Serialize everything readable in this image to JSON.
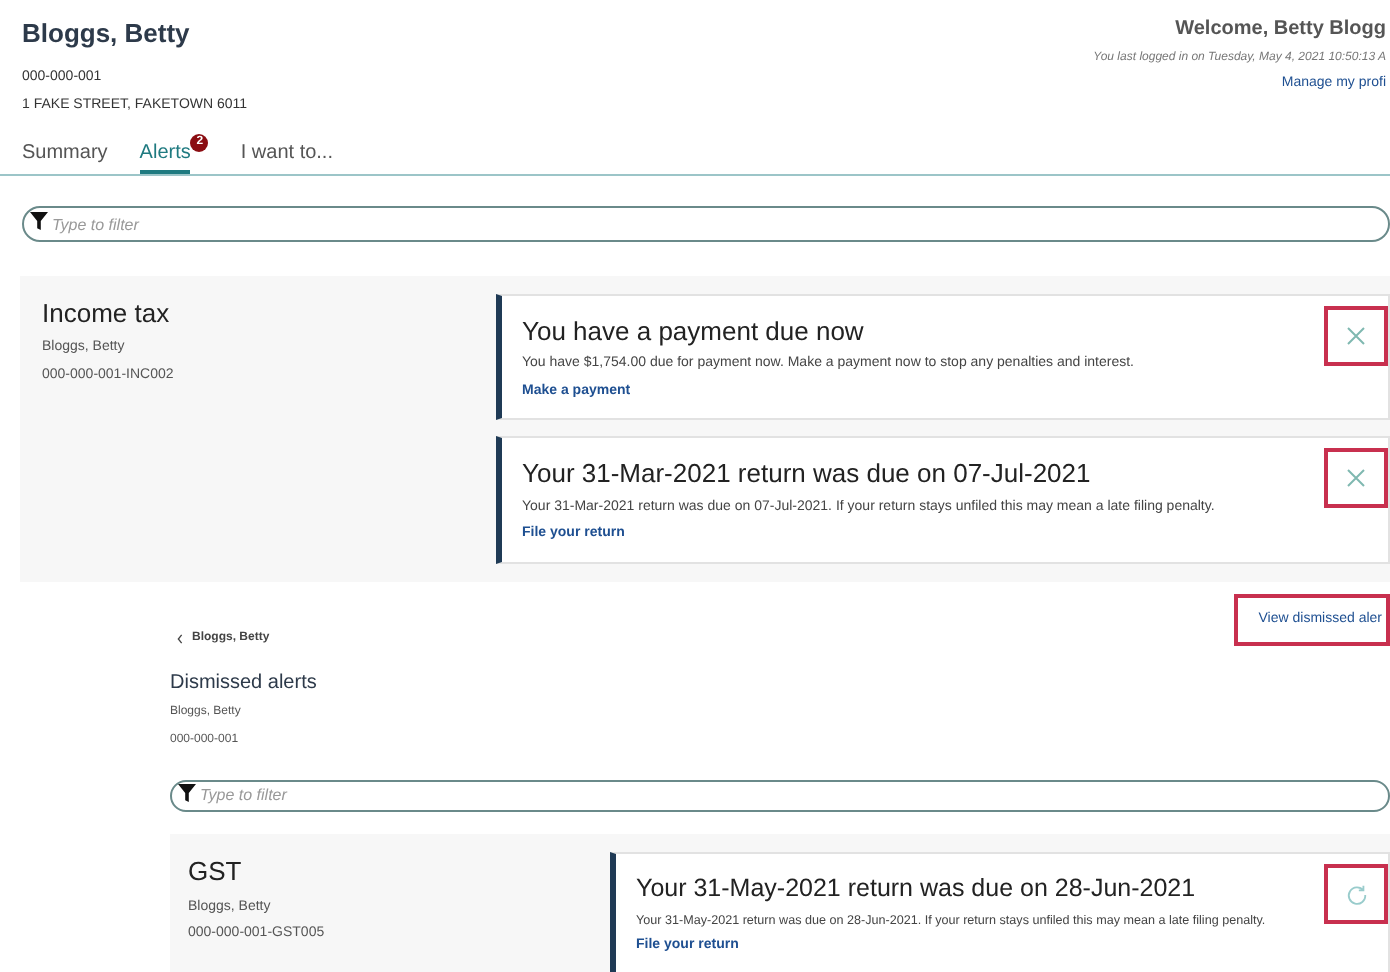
{
  "header": {
    "name": "Bloggs, Betty",
    "account": "000-000-001",
    "address": "1 FAKE STREET, FAKETOWN 6011",
    "welcome": "Welcome, Betty Blogg",
    "last_login": "You last logged in on Tuesday, May 4, 2021 10:50:13 A",
    "profile_link": "Manage my profi"
  },
  "tabs": [
    {
      "label": "Summary",
      "selected": false
    },
    {
      "label": "Alerts",
      "selected": true,
      "badge": "2"
    },
    {
      "label": "I want to...",
      "selected": false
    }
  ],
  "filter": {
    "placeholder": "Type to filter"
  },
  "groups": [
    {
      "title": "Income tax",
      "owner": "Bloggs, Betty",
      "reference": "000-000-001-INC002",
      "alerts": [
        {
          "title": "You have a payment due now",
          "text": "You have $1,754.00 due for payment now. Make a payment now to stop any penalties and interest.",
          "link": "Make a payment",
          "kind": "dismiss",
          "highlighted": true
        },
        {
          "title": "Your 31-Mar-2021 return was due on 07-Jul-2021",
          "text": "Your 31-Mar-2021 return was due on 07-Jul-2021. If your return stays unfiled this may mean a late filing penalty.",
          "link": "File your return",
          "kind": "dismiss",
          "highlighted": true
        }
      ]
    }
  ],
  "dismissed_link": {
    "label": "View dismissed aler",
    "highlighted": true
  },
  "dismissed": {
    "back": "Bloggs, Betty",
    "title": "Dismissed alerts",
    "owner": "Bloggs, Betty",
    "account": "000-000-001",
    "filter": {
      "placeholder": "Type to filter"
    },
    "groups": [
      {
        "title": "GST",
        "owner": "Bloggs, Betty",
        "reference": "000-000-001-GST005",
        "alerts": [
          {
            "title": "Your 31-May-2021 return was due on 28-Jun-2021",
            "text": "Your 31-May-2021 return was due on 28-Jun-2021. If your return stays unfiled this may mean a late filing penalty.",
            "link": "File your return",
            "kind": "restore",
            "highlighted": true
          }
        ]
      }
    ]
  }
}
